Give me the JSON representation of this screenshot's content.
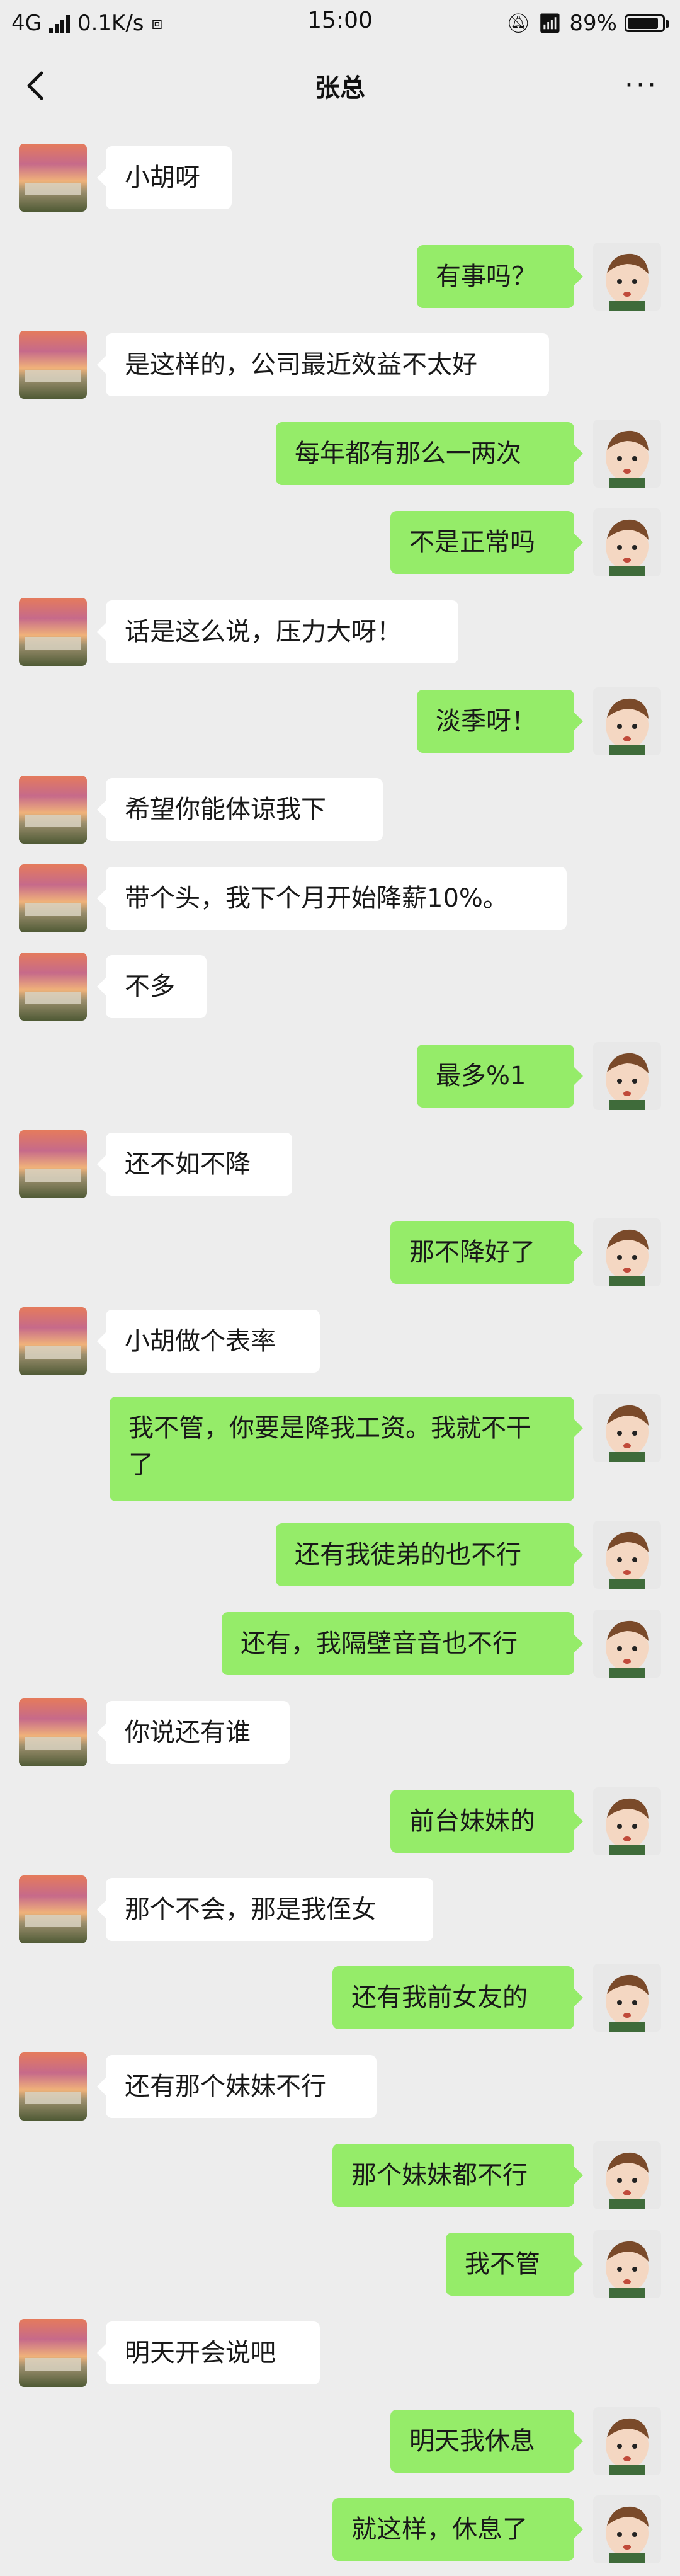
{
  "status_bar": {
    "network": "4G",
    "speed": "0.1K/s",
    "time": "15:00",
    "battery": "89%",
    "battery_level": 0.89
  },
  "header": {
    "title": "张总",
    "more_label": "···"
  },
  "messages": [
    {
      "side": "left",
      "text": "小胡呀"
    },
    {
      "side": "right",
      "text": "有事吗？"
    },
    {
      "side": "left",
      "text": "是这样的，公司最近效益不太好"
    },
    {
      "side": "right",
      "text": "每年都有那么一两次"
    },
    {
      "side": "right",
      "text": "不是正常吗"
    },
    {
      "side": "left",
      "text": "话是这么说，压力大呀！"
    },
    {
      "side": "right",
      "text": "淡季呀！"
    },
    {
      "side": "left",
      "text": "希望你能体谅我下"
    },
    {
      "side": "left",
      "text": "带个头，我下个月开始降薪10%。"
    },
    {
      "side": "left",
      "text": "不多"
    },
    {
      "side": "right",
      "text": "最多%1"
    },
    {
      "side": "left",
      "text": "还不如不降"
    },
    {
      "side": "right",
      "text": "那不降好了"
    },
    {
      "side": "left",
      "text": "小胡做个表率"
    },
    {
      "side": "right",
      "text": "我不管，你要是降我工资。我就不干了"
    },
    {
      "side": "right",
      "text": "还有我徒弟的也不行"
    },
    {
      "side": "right",
      "text": "还有，我隔壁音音也不行"
    },
    {
      "side": "left",
      "text": "你说还有谁"
    },
    {
      "side": "right",
      "text": "前台妹妹的"
    },
    {
      "side": "left",
      "text": "那个不会，那是我侄女"
    },
    {
      "side": "right",
      "text": "还有我前女友的"
    },
    {
      "side": "left",
      "text": "还有那个妹妹不行"
    },
    {
      "side": "right",
      "text": "那个妹妹都不行"
    },
    {
      "side": "right",
      "text": "我不管"
    },
    {
      "side": "left",
      "text": "明天开会说吧"
    },
    {
      "side": "right",
      "text": "明天我休息"
    },
    {
      "side": "right",
      "text": "就这样，休息了"
    }
  ],
  "colors": {
    "background": "#ededed",
    "my_bubble": "#95ec69",
    "their_bubble": "#ffffff"
  }
}
